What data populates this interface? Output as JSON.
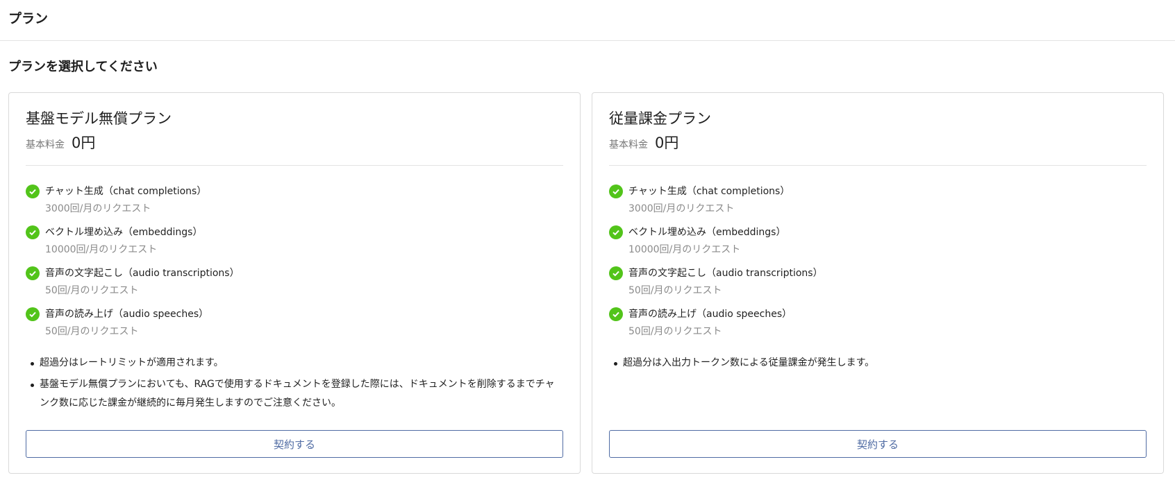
{
  "header": {
    "title": "プラン"
  },
  "section": {
    "title": "プランを選択してください"
  },
  "plans": [
    {
      "name": "基盤モデル無償プラン",
      "price_label": "基本料金",
      "price_value": "0円",
      "features": [
        {
          "title": "チャット生成（chat completions）",
          "limit": "3000回/月のリクエスト"
        },
        {
          "title": "ベクトル埋め込み（embeddings）",
          "limit": "10000回/月のリクエスト"
        },
        {
          "title": "音声の文字起こし（audio transcriptions）",
          "limit": "50回/月のリクエスト"
        },
        {
          "title": "音声の読み上げ（audio speeches）",
          "limit": "50回/月のリクエスト"
        }
      ],
      "notes": [
        "超過分はレートリミットが適用されます。",
        "基盤モデル無償プランにおいても、RAGで使用するドキュメントを登録した際には、ドキュメントを削除するまでチャンク数に応じた課金が継続的に毎月発生しますのでご注意ください。"
      ],
      "button_label": "契約する"
    },
    {
      "name": "従量課金プラン",
      "price_label": "基本料金",
      "price_value": "0円",
      "features": [
        {
          "title": "チャット生成（chat completions）",
          "limit": "3000回/月のリクエスト"
        },
        {
          "title": "ベクトル埋め込み（embeddings）",
          "limit": "10000回/月のリクエスト"
        },
        {
          "title": "音声の文字起こし（audio transcriptions）",
          "limit": "50回/月のリクエスト"
        },
        {
          "title": "音声の読み上げ（audio speeches）",
          "limit": "50回/月のリクエスト"
        }
      ],
      "notes": [
        "超過分は入出力トークン数による従量課金が発生します。"
      ],
      "button_label": "契約する"
    }
  ],
  "icons": {
    "feature": "check-circle-icon"
  },
  "colors": {
    "check": "#52c41a",
    "button": "#4f6ba3"
  }
}
